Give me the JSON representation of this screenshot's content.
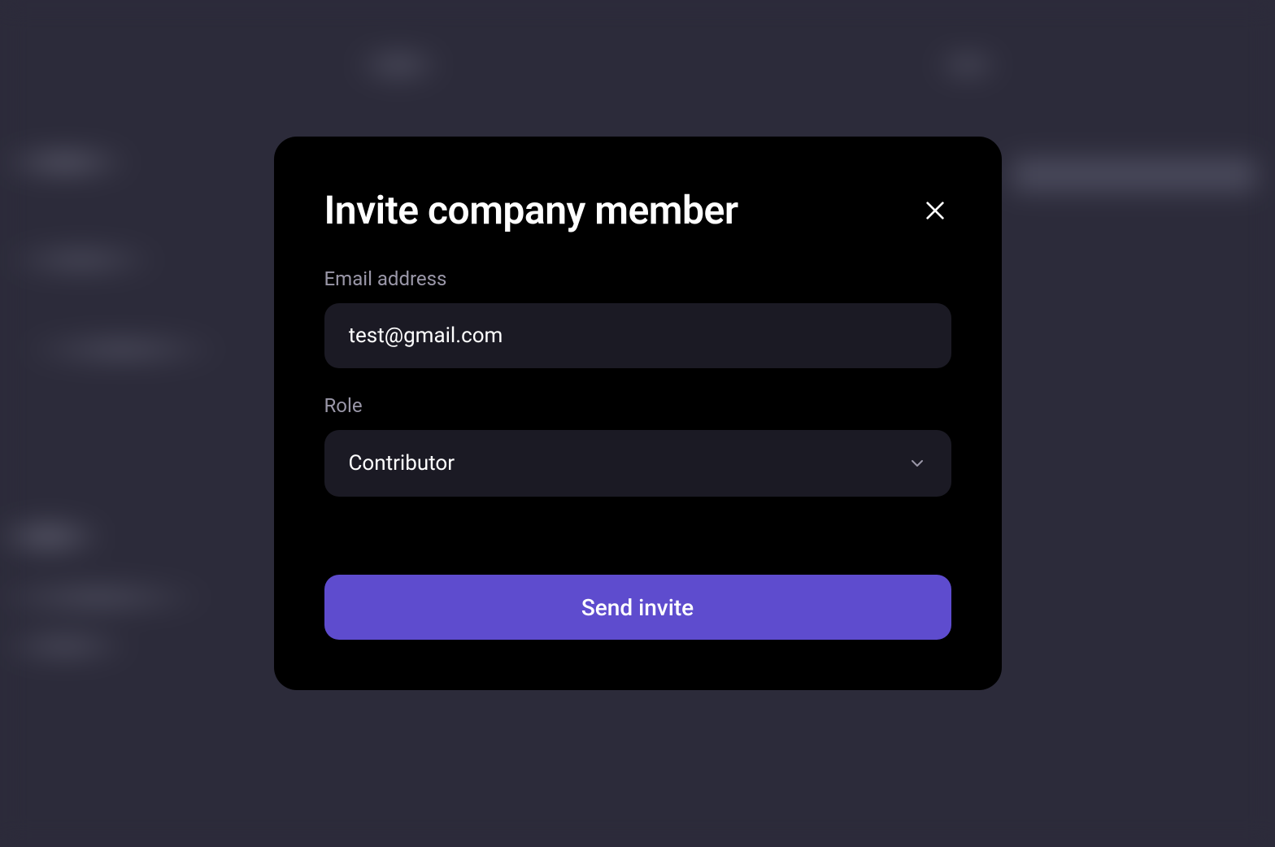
{
  "modal": {
    "title": "Invite company member",
    "email": {
      "label": "Email address",
      "value": "test@gmail.com"
    },
    "role": {
      "label": "Role",
      "selected": "Contributor"
    },
    "submit_label": "Send invite"
  }
}
